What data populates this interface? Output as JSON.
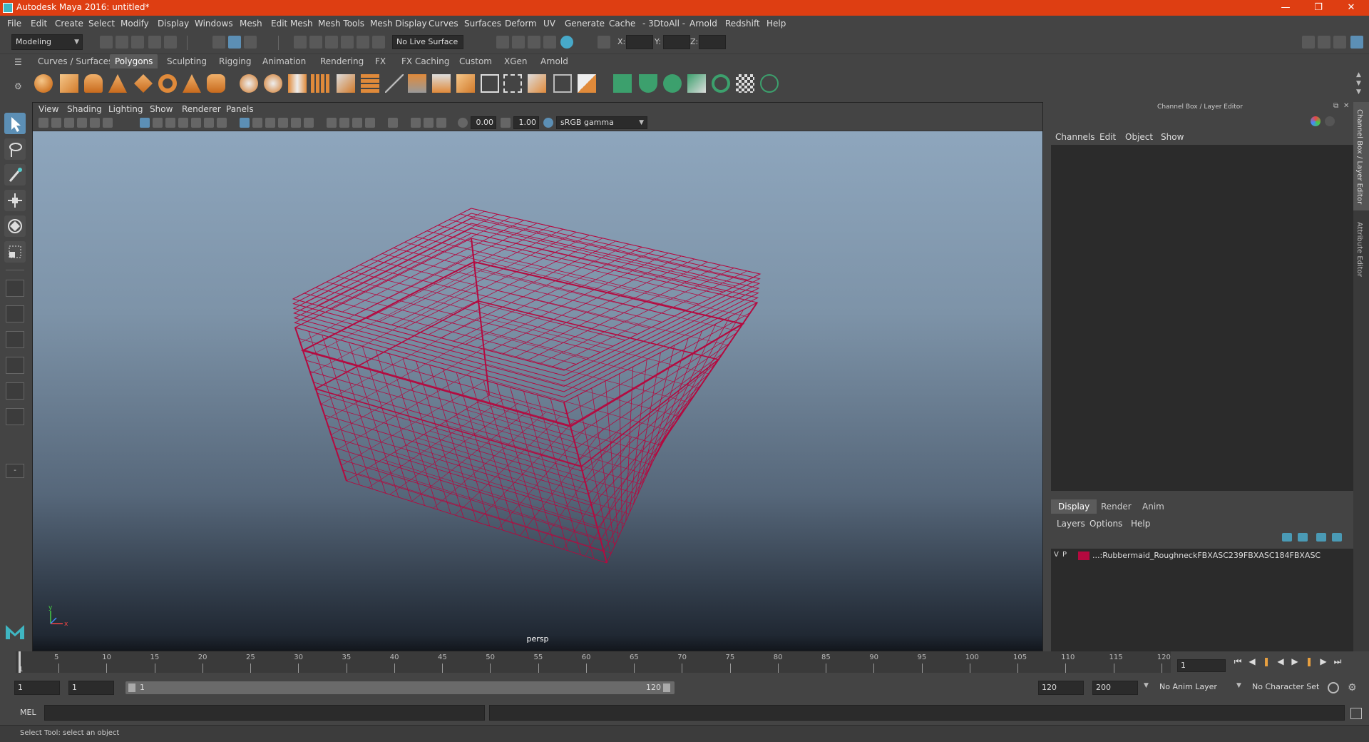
{
  "window": {
    "title": "Autodesk Maya 2016: untitled*",
    "accent": "#de3e12"
  },
  "menubar": [
    "File",
    "Edit",
    "Create",
    "Select",
    "Modify",
    "Display",
    "Windows",
    "Mesh",
    "Edit Mesh",
    "Mesh Tools",
    "Mesh Display",
    "Curves",
    "Surfaces",
    "Deform",
    "UV",
    "Generate",
    "Cache",
    "- 3DtoAll -",
    "Arnold",
    "Redshift",
    "Help"
  ],
  "statusline": {
    "mode": "Modeling",
    "live_surface": "No Live Surface",
    "x_label": "X:",
    "y_label": "Y:",
    "z_label": "Z:"
  },
  "shelf_tabs": [
    "Curves / Surfaces",
    "Polygons",
    "Sculpting",
    "Rigging",
    "Animation",
    "Rendering",
    "FX",
    "FX Caching",
    "Custom",
    "XGen",
    "Arnold"
  ],
  "active_shelf_tab": "Polygons",
  "viewport": {
    "menu": [
      "View",
      "Shading",
      "Lighting",
      "Show",
      "Renderer",
      "Panels"
    ],
    "exposure": "0.00",
    "gamma": "1.00",
    "color_space": "sRGB gamma",
    "camera": "persp",
    "wire_color": "#b5093f"
  },
  "right_panel": {
    "title": "Channel Box / Layer Editor",
    "menu": [
      "Channels",
      "Edit",
      "Object",
      "Show"
    ],
    "tabs": [
      "Display",
      "Render",
      "Anim"
    ],
    "active_tab": "Display",
    "layer_menu": [
      "Layers",
      "Options",
      "Help"
    ],
    "layer": {
      "v": "V",
      "p": "P",
      "color": "#b5093f",
      "name": "...:Rubbermaid_RoughneckFBXASC239FBXASC184FBXASC"
    }
  },
  "side_tabs": [
    "Channel Box / Layer Editor",
    "Attribute Editor"
  ],
  "timeline": {
    "ticks": [
      "5",
      "10",
      "15",
      "20",
      "25",
      "30",
      "35",
      "40",
      "45",
      "50",
      "55",
      "60",
      "65",
      "70",
      "75",
      "80",
      "85",
      "90",
      "95",
      "100",
      "105",
      "110",
      "115",
      "120"
    ],
    "current": "1",
    "start_label": "1"
  },
  "range": {
    "start": "1",
    "playback_start": "1",
    "range_start": "1",
    "range_end": "120",
    "playback_end": "120",
    "end": "200",
    "anim_layer": "No Anim Layer",
    "char_set": "No Character Set"
  },
  "cmdline": {
    "label": "MEL"
  },
  "help": "Select Tool: select an object"
}
